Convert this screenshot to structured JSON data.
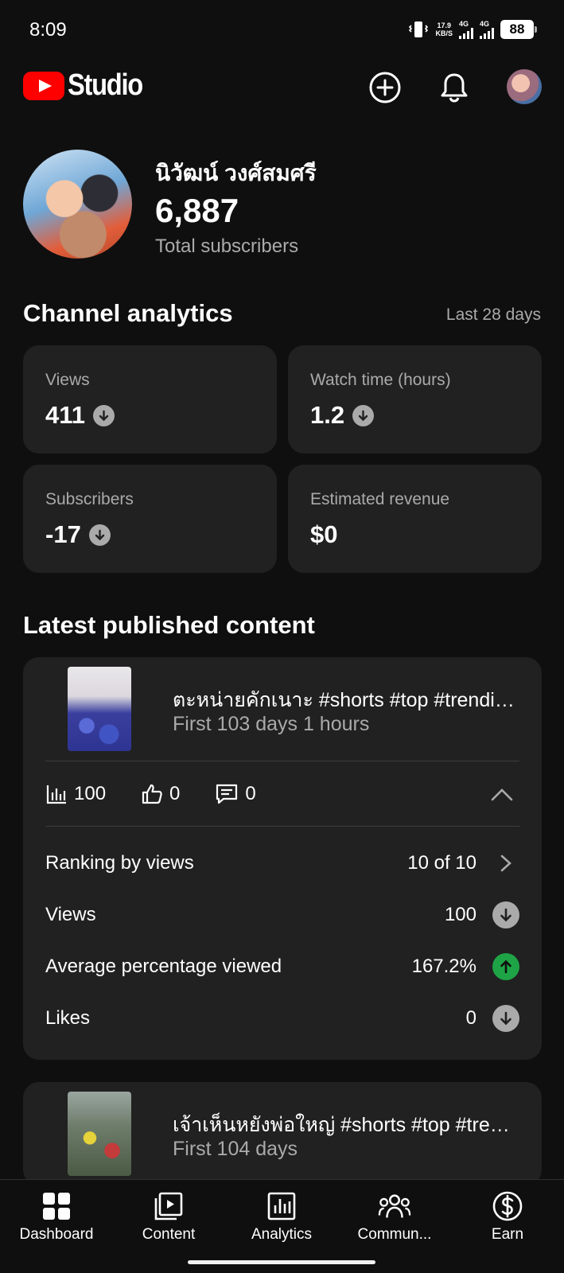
{
  "status_bar": {
    "time": "8:09",
    "net_speed_value": "17.9",
    "net_speed_unit": "KB/S",
    "sim1": "4G",
    "sim2": "4G",
    "battery": "88"
  },
  "header": {
    "app_name": "Studio",
    "icons": [
      "create-icon",
      "bell-icon",
      "avatar"
    ]
  },
  "channel": {
    "name": "นิวัฒน์ วงศ์สมศรี",
    "subscribers": "6,887",
    "subscribers_label": "Total subscribers"
  },
  "analytics": {
    "title": "Channel analytics",
    "period": "Last 28 days",
    "metrics": [
      {
        "label": "Views",
        "value": "411",
        "trend": "down"
      },
      {
        "label": "Watch time (hours)",
        "value": "1.2",
        "trend": "down"
      },
      {
        "label": "Subscribers",
        "value": "-17",
        "trend": "down"
      },
      {
        "label": "Estimated revenue",
        "value": "$0",
        "trend": "none"
      }
    ]
  },
  "latest": {
    "title": "Latest published content",
    "items": [
      {
        "title": "ตะหน่ายคักเนาะ  #shorts #top #trending",
        "subtitle": "First 103 days 1 hours",
        "views": "100",
        "likes": "0",
        "comments": "0",
        "details": [
          {
            "label": "Ranking by views",
            "value": "10 of 10",
            "indicator": "chevron-right"
          },
          {
            "label": "Views",
            "value": "100",
            "indicator": "down"
          },
          {
            "label": "Average percentage viewed",
            "value": "167.2%",
            "indicator": "up"
          },
          {
            "label": "Likes",
            "value": "0",
            "indicator": "down"
          }
        ]
      },
      {
        "title": "เจ้าเห็นหยังพ่อใหญ่ #shorts #top #trending",
        "subtitle": "First 104 days"
      }
    ]
  },
  "bottom_nav": [
    {
      "label": "Dashboard",
      "icon": "dashboard-icon",
      "active": true
    },
    {
      "label": "Content",
      "icon": "content-icon"
    },
    {
      "label": "Analytics",
      "icon": "analytics-icon"
    },
    {
      "label": "Commun...",
      "icon": "community-icon"
    },
    {
      "label": "Earn",
      "icon": "earn-icon"
    }
  ],
  "colors": {
    "background": "#0f0f0f",
    "card": "#212121",
    "brand_red": "#ff0000",
    "trend_up": "#1ea446",
    "trend_down": "#aaaaaa",
    "secondary_text": "#aaaaaa"
  }
}
